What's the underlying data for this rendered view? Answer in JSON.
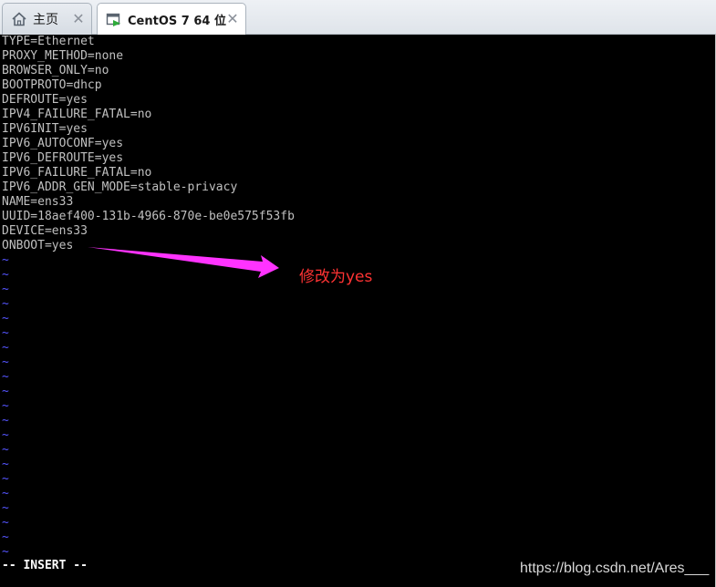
{
  "tabs": [
    {
      "label": "主页",
      "icon": "home-icon"
    },
    {
      "label": "CentOS 7 64 位",
      "icon": "vm-icon"
    }
  ],
  "config_lines": [
    "TYPE=Ethernet",
    "PROXY_METHOD=none",
    "BROWSER_ONLY=no",
    "BOOTPROTO=dhcp",
    "DEFROUTE=yes",
    "IPV4_FAILURE_FATAL=no",
    "IPV6INIT=yes",
    "IPV6_AUTOCONF=yes",
    "IPV6_DEFROUTE=yes",
    "IPV6_FAILURE_FATAL=no",
    "IPV6_ADDR_GEN_MODE=stable-privacy",
    "NAME=ens33",
    "UUID=18aef400-131b-4966-870e-be0e575f53fb",
    "DEVICE=ens33",
    "ONBOOT=yes"
  ],
  "empty_line_marker": "~",
  "status_line": "-- INSERT --",
  "annotation": {
    "text": "修改为yes",
    "color": "#ff3333",
    "arrow_color": "#ff33ff"
  },
  "watermark": "https://blog.csdn.net/Ares___"
}
